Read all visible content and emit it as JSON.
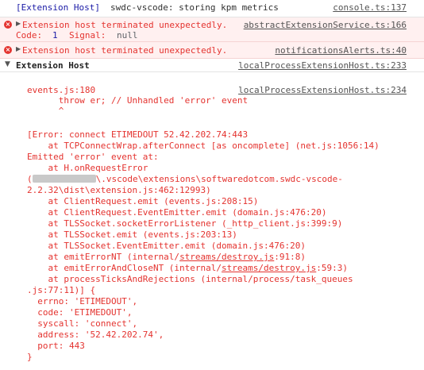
{
  "console": {
    "rows": [
      {
        "prefix": "[Extension Host]",
        "message": "swdc-vscode: storing kpm metrics",
        "source": "console.ts:137"
      },
      {
        "message": "Extension host terminated unexpectedly.",
        "detail_code_label": "Code:",
        "detail_code_value": "1",
        "detail_signal_label": "Signal:",
        "detail_signal_value": "null",
        "source": "abstractExtensionService.ts:166"
      },
      {
        "message": "Extension host terminated unexpectedly.",
        "source": "notificationsAlerts.ts:40"
      }
    ],
    "group": {
      "title": "Extension Host",
      "source": "localProcessExtensionHost.ts:233"
    },
    "stack": {
      "source": "localProcessExtensionHost.ts:234",
      "lines": [
        "events.js:180",
        "      throw er; // Unhandled 'error' event",
        "      ^",
        "",
        "[Error: connect ETIMEDOUT 52.42.202.74:443",
        "    at TCPConnectWrap.afterConnect [as oncomplete] (net.js:1056:14)",
        "Emitted 'error' event at:",
        "    at H.onRequestError",
        "",
        "2.2.32\\dist\\extension.js:462:12993)",
        "    at ClientRequest.emit (events.js:208:15)",
        "    at ClientRequest.EventEmitter.emit (domain.js:476:20)",
        "    at TLSSocket.socketErrorListener (_http_client.js:399:9)",
        "    at TLSSocket.emit (events.js:203:13)",
        "    at TLSSocket.EventEmitter.emit (domain.js:476:20)",
        "",
        "",
        "    at processTicksAndRejections (internal/process/task_queues",
        ".js:77:11)] {",
        "  errno: 'ETIMEDOUT',",
        "  code: 'ETIMEDOUT',",
        "  syscall: 'connect',",
        "  address: '52.42.202.74',",
        "  port: 443",
        "}"
      ],
      "path_line": {
        "open": "(",
        "rest": "\\.vscode\\extensions\\softwaredotcom.swdc-vscode-"
      },
      "destroy_line_1": {
        "pre": "    at emitErrorNT (internal/",
        "link": "streams/destroy.js",
        "post": ":91:8)"
      },
      "destroy_line_2": {
        "pre": "    at emitErrorAndCloseNT (internal/",
        "link": "streams/destroy.js",
        "post": ":59:3)"
      }
    }
  }
}
